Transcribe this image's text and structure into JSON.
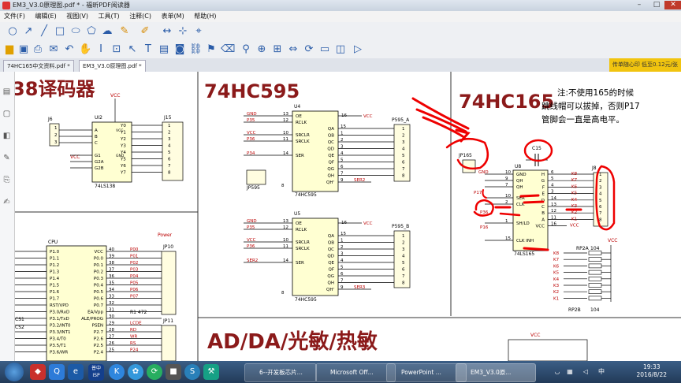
{
  "window": {
    "title": "EM3_V3.0原理图.pdf * - 福昕PDF阅读器"
  },
  "menu": [
    "文件(F)",
    "编辑(E)",
    "视图(V)",
    "工具(T)",
    "注释(C)",
    "表单(M)",
    "帮助(H)"
  ],
  "tabs": [
    {
      "label": "74HC165中文资料.pdf *",
      "active": false
    },
    {
      "label": "EM3_V3.0原理图.pdf *",
      "active": true
    }
  ],
  "promo": "传单随心印 低至0.12元/张",
  "schematic": {
    "sections": {
      "decoder": "38译码器",
      "hc595": "74HC595",
      "hc165": "74HC165",
      "adda": "AD/DA/光敏/热敏"
    },
    "note": [
      "注:不使用165的时候",
      "跳线帽可以拔掉，否则P17",
      "管脚会一直是高电平。"
    ],
    "u12": {
      "ref": "UI2",
      "part": "74LS138",
      "j6": "J6",
      "j15": "J15",
      "pins_left": [
        "A",
        "B",
        "C",
        "G1",
        "G2A",
        "G2B"
      ],
      "pins_right": [
        "Y0",
        "Y1",
        "Y2",
        "Y3",
        "Y4",
        "Y5",
        "Y6",
        "Y7"
      ],
      "pin_nums": [
        "1",
        "2",
        "3",
        "4",
        "5",
        "6",
        "7",
        "8"
      ],
      "vcc": "VCC",
      "gnd": "GND"
    },
    "u4": {
      "ref": "U4",
      "part": "74HC595",
      "conn": "P595_A",
      "jumper": "JP595",
      "left_pins": [
        "OE",
        "RCLK",
        "SRCLR",
        "SRCLK",
        "SER"
      ],
      "left_nums": [
        "13",
        "12",
        "10",
        "11",
        "14"
      ],
      "left_nets": [
        "GND",
        "P35",
        "VCC",
        "P36",
        "P34"
      ],
      "right_pins": [
        "QA",
        "QB",
        "QC",
        "QD",
        "QE",
        "QF",
        "QG",
        "QH",
        "QH'"
      ],
      "right_nums": [
        "15",
        "1",
        "2",
        "3",
        "4",
        "5",
        "6",
        "7",
        "9"
      ],
      "ser_out": "SER2",
      "vcc_num": "16",
      "gnd_num": "8"
    },
    "u5": {
      "ref": "U5",
      "part": "74HC595",
      "conn": "P595_B",
      "left_pins": [
        "OE",
        "RCLK",
        "SRCLR",
        "SRCLK",
        "SER"
      ],
      "left_nums": [
        "13",
        "12",
        "10",
        "11",
        "14"
      ],
      "left_nets": [
        "GND",
        "P35",
        "VCC",
        "P36",
        "SER2"
      ],
      "right_pins": [
        "QA",
        "QB",
        "QC",
        "QD",
        "QE",
        "QF",
        "QG",
        "QH",
        "QH'"
      ],
      "right_nums": [
        "15",
        "1",
        "2",
        "3",
        "4",
        "5",
        "6",
        "7",
        "9"
      ],
      "ser_out": "SER3",
      "vcc_num": "16",
      "gnd_num": "8"
    },
    "u8": {
      "ref": "U8",
      "part": "74LS165",
      "cap": "C15",
      "jumper": "JP165",
      "conn": "J8",
      "left_pins": [
        "GND",
        "QH",
        "QH",
        "SER",
        "CLK",
        "SH/LD",
        "CLK INH"
      ],
      "left_nums": [
        "10",
        "9",
        "7",
        "10",
        "2",
        "1",
        "15"
      ],
      "right_pins": [
        "H",
        "G",
        "F",
        "E",
        "D",
        "C",
        "B",
        "A",
        "VCC"
      ],
      "right_nums": [
        "6",
        "5",
        "4",
        "3",
        "14",
        "13",
        "12",
        "11",
        "16"
      ],
      "right_nets": [
        "K8",
        "K7",
        "K6",
        "K5",
        "K4",
        "K3",
        "K2",
        "K1"
      ],
      "nets_left": [
        "GND",
        "P17",
        "P36",
        "P16"
      ],
      "vcc": "VCC"
    },
    "cpu": {
      "label": "CPU",
      "power": "Power",
      "jp10": "JP10",
      "jp11": "JP11",
      "pins_left": [
        "P1.0",
        "P1.1",
        "P1.2",
        "P1.3",
        "P1.4",
        "P1.5",
        "P1.6",
        "P1.7",
        "RST/VPD",
        "P3.0/RxD",
        "P3.1/TxD",
        "P3.2/INT0",
        "P3.3/INT1",
        "P3.4/T0",
        "P3.5/T1",
        "P3.6/WR"
      ],
      "pins_right": [
        "VCC",
        "P0.0",
        "P0.1",
        "P0.2",
        "P0.3",
        "P0.4",
        "P0.5",
        "P0.6",
        "P0.7",
        "EA/Vpp",
        "ALE/PROG",
        "PSEN",
        "P2.7",
        "P2.6",
        "P2.5",
        "P2.4"
      ],
      "right_nums": [
        "40",
        "39",
        "38",
        "37",
        "36",
        "35",
        "34",
        "33",
        "32",
        "31",
        "30",
        "29",
        "28",
        "27",
        "26",
        "25"
      ],
      "nets": [
        "P00",
        "P01",
        "P02",
        "P03",
        "P04",
        "P05",
        "P06",
        "P07",
        "",
        "",
        "",
        "LCDE",
        "RD",
        "WR",
        "RS",
        "P24"
      ],
      "misc": [
        "R1 472",
        "CS1",
        "CS2"
      ]
    },
    "rp2": {
      "a": "RP2A",
      "b": "RP2B",
      "val": "104",
      "nets": [
        "K8",
        "K7",
        "K6",
        "K5",
        "K4",
        "K3",
        "K2",
        "K1"
      ],
      "vcc": "VCC"
    }
  },
  "taskbar": {
    "tasks": [
      "6--开发板芯片...",
      "Microsoft Off...",
      "PowerPoint ...",
      "EM3_V3.0原..."
    ],
    "clock_time": "19:33",
    "clock_date": "2016/8/22",
    "apps": [
      "普中 ISP"
    ]
  }
}
